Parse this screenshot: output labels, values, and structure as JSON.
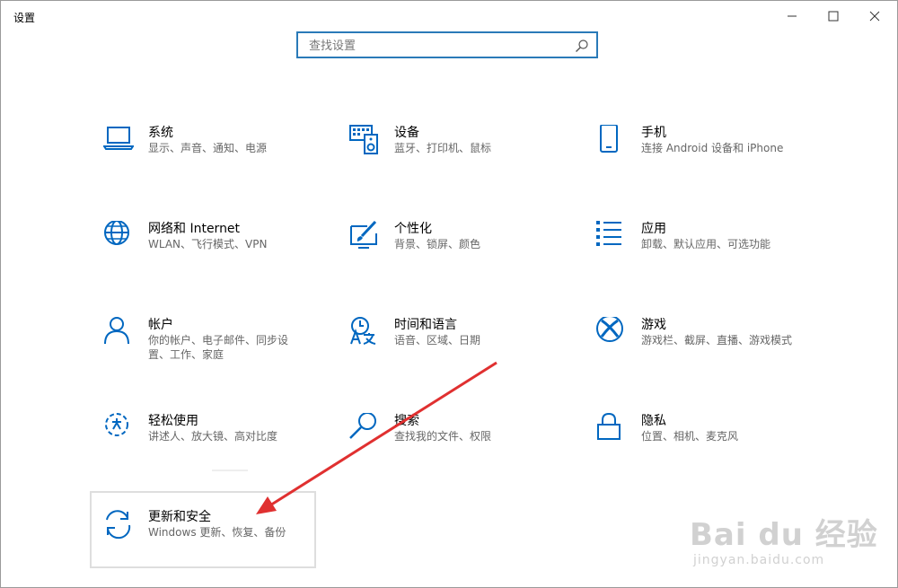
{
  "window": {
    "title": "设置"
  },
  "search": {
    "placeholder": "查找设置"
  },
  "tiles": [
    {
      "title": "系统",
      "subtitle": "显示、声音、通知、电源",
      "icon": "laptop-icon"
    },
    {
      "title": "设备",
      "subtitle": "蓝牙、打印机、鼠标",
      "icon": "keyboard-speaker-icon"
    },
    {
      "title": "手机",
      "subtitle": "连接 Android 设备和 iPhone",
      "icon": "phone-icon"
    },
    {
      "title": "网络和 Internet",
      "subtitle": "WLAN、飞行模式、VPN",
      "icon": "globe-icon"
    },
    {
      "title": "个性化",
      "subtitle": "背景、锁屏、颜色",
      "icon": "paint-brush-icon"
    },
    {
      "title": "应用",
      "subtitle": "卸载、默认应用、可选功能",
      "icon": "app-list-icon"
    },
    {
      "title": "帐户",
      "subtitle": "你的帐户、电子邮件、同步设",
      "subtitle2": "置、工作、家庭",
      "icon": "person-icon"
    },
    {
      "title": "时间和语言",
      "subtitle": "语音、区域、日期",
      "icon": "clock-language-icon"
    },
    {
      "title": "游戏",
      "subtitle": "游戏栏、截屏、直播、游戏模式",
      "icon": "xbox-icon"
    },
    {
      "title": "轻松使用",
      "subtitle": "讲述人、放大镜、高对比度",
      "icon": "ease-of-access-icon"
    },
    {
      "title": "搜索",
      "subtitle": "查找我的文件、权限",
      "icon": "magnifier-icon"
    },
    {
      "title": "隐私",
      "subtitle": "位置、相机、麦克风",
      "icon": "lock-icon"
    },
    {
      "title": "更新和安全",
      "subtitle": "Windows 更新、恢复、备份",
      "icon": "sync-icon"
    }
  ],
  "watermark": {
    "text": "Bai du 经验",
    "sub": "jingyan.baidu.com"
  },
  "colors": {
    "accent": "#0067c0",
    "annotation": "#e03030"
  }
}
